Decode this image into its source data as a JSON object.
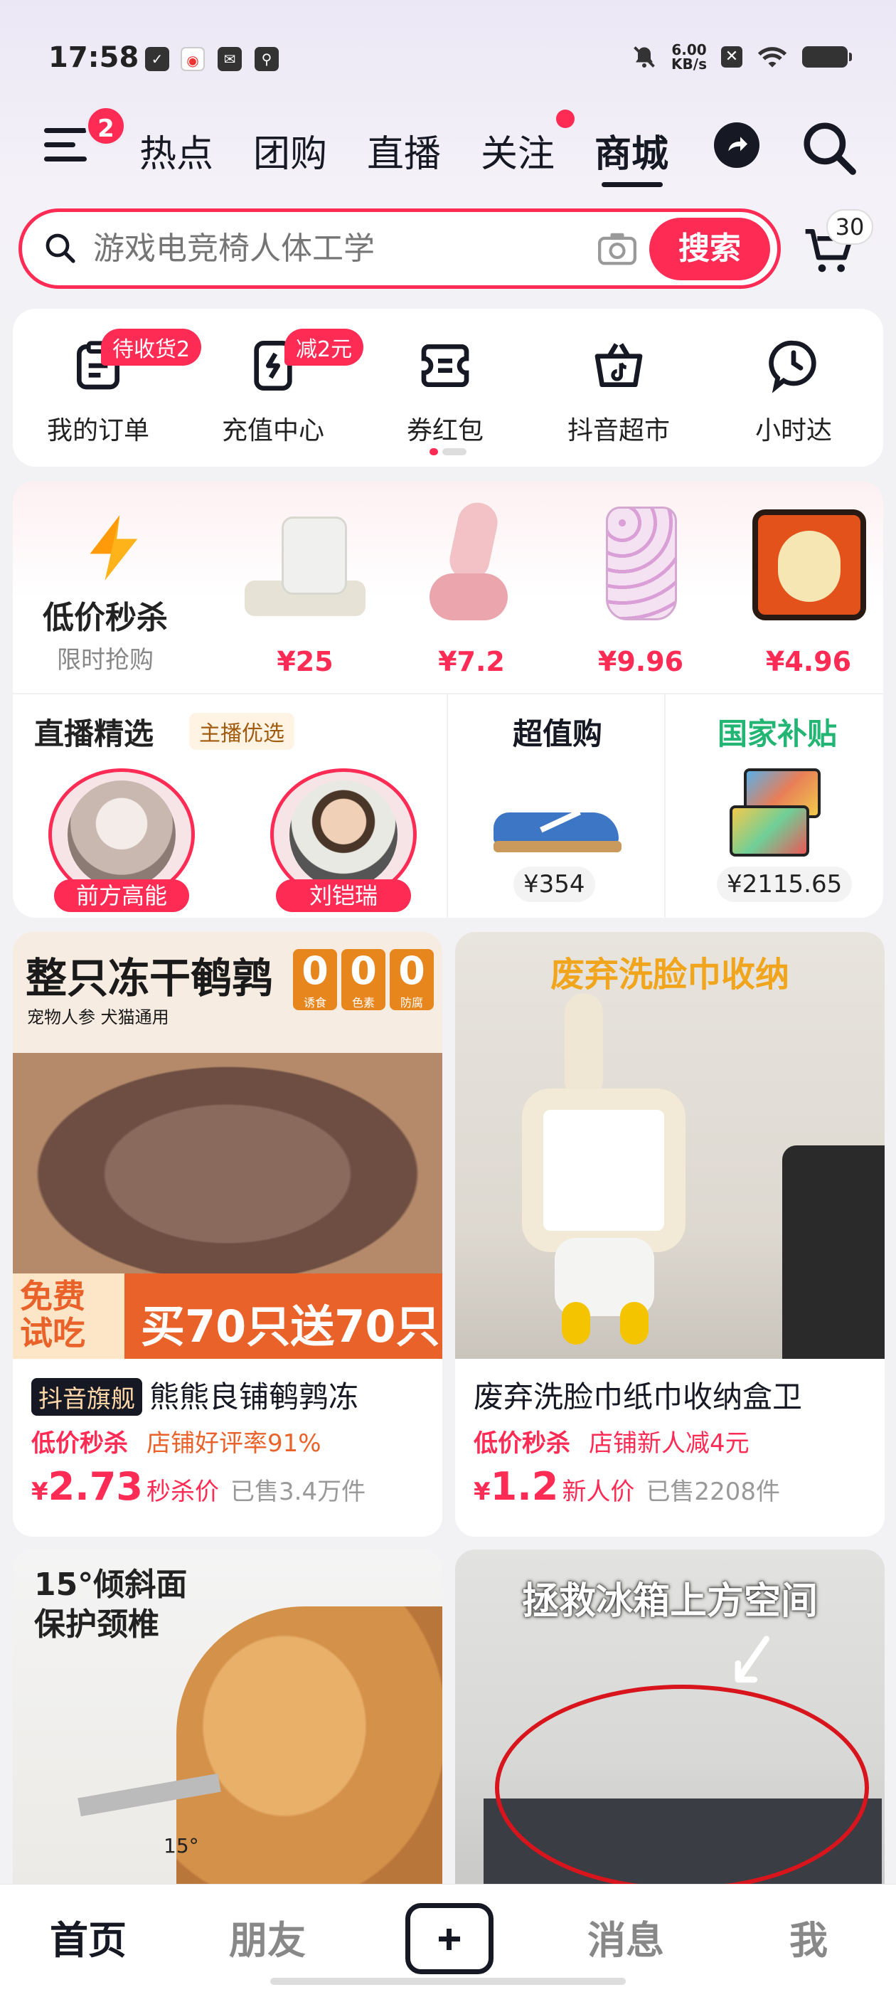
{
  "status_bar": {
    "time": "17:58",
    "net_speed_value": "6.00",
    "net_speed_unit": "KB/s"
  },
  "nav": {
    "menu_badge": "2",
    "tabs": [
      {
        "label": "热点"
      },
      {
        "label": "团购"
      },
      {
        "label": "直播"
      },
      {
        "label": "关注"
      },
      {
        "label": "商城",
        "active": true
      }
    ]
  },
  "search": {
    "placeholder": "游戏电竞椅人体工学",
    "button_label": "搜索",
    "cart_count": "30"
  },
  "shortcuts": [
    {
      "label": "我的订单",
      "badge": "待收货2",
      "icon": "order-icon"
    },
    {
      "label": "充值中心",
      "badge": "减2元",
      "icon": "recharge-icon"
    },
    {
      "label": "券红包",
      "badge": "",
      "icon": "coupon-icon"
    },
    {
      "label": "抖音超市",
      "badge": "",
      "icon": "supermarket-icon"
    },
    {
      "label": "小时达",
      "badge": "",
      "icon": "clock-icon"
    }
  ],
  "flash_sale": {
    "title": "低价秒杀",
    "subtitle": "限时抢购",
    "products": [
      {
        "price": "¥25",
        "icon": "pet-feeder-image"
      },
      {
        "price": "¥7.2",
        "icon": "massager-image"
      },
      {
        "price": "¥9.96",
        "icon": "apron-image"
      },
      {
        "price": "¥4.96",
        "icon": "pillow-image"
      }
    ]
  },
  "live": {
    "title": "直播精选",
    "tag": "主播优选",
    "anchors": [
      {
        "name": "前方高能"
      },
      {
        "name": "刘铠瑞"
      }
    ]
  },
  "deals": [
    {
      "title": "超值购",
      "price": "¥354",
      "color": "#161823"
    },
    {
      "title": "国家补贴",
      "price": "¥2115.65",
      "color": "#22b573"
    }
  ],
  "products": [
    {
      "banner_title": "整只冻干鹌鹑",
      "banner_sub": "宠物人参 犬猫通用",
      "zeros": [
        "0",
        "0",
        "0"
      ],
      "zero_labels": [
        "诱食",
        "色素",
        "防腐"
      ],
      "free_trial": [
        "免费",
        "试吃"
      ],
      "promo": "买70只送70只",
      "brand_tag": "抖音旗舰",
      "title": "熊熊良铺鹌鹑冻",
      "tag1": "低价秒杀",
      "tag2": "店铺好评率91%",
      "currency": "¥",
      "price": "2.73",
      "price_label": "秒杀价",
      "sold": "已售3.4万件"
    },
    {
      "banner_title": "废弃洗脸巾收纳",
      "title": "废弃洗脸巾纸巾收纳盒卫",
      "tag1": "低价秒杀",
      "tag2": "店铺新人减4元",
      "currency": "¥",
      "price": "1.2",
      "price_label": "新人价",
      "sold": "已售2208件"
    },
    {
      "banner_title": "15°倾斜面",
      "banner_title2": "保护颈椎",
      "angle_label": "15°"
    },
    {
      "banner_title": "拯救冰箱上方空间"
    }
  ],
  "bottom_nav": [
    {
      "label": "首页",
      "active": true
    },
    {
      "label": "朋友"
    },
    {
      "label": "消息"
    },
    {
      "label": "我"
    }
  ],
  "colors": {
    "accent": "#fe2c55",
    "text": "#161823",
    "muted": "#888888"
  }
}
